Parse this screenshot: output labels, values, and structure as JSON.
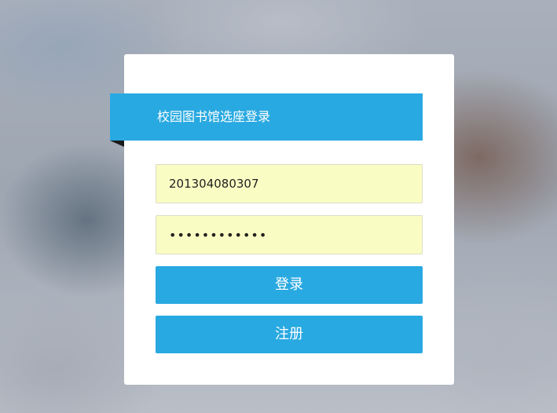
{
  "login_card": {
    "title": "校园图书馆选座登录",
    "username_value": "201304080307",
    "password_value": "••••••••••••",
    "login_label": "登录",
    "register_label": "注册"
  },
  "colors": {
    "accent": "#29a9e1",
    "input_background": "#fafdc3",
    "card_background": "#ffffff"
  }
}
